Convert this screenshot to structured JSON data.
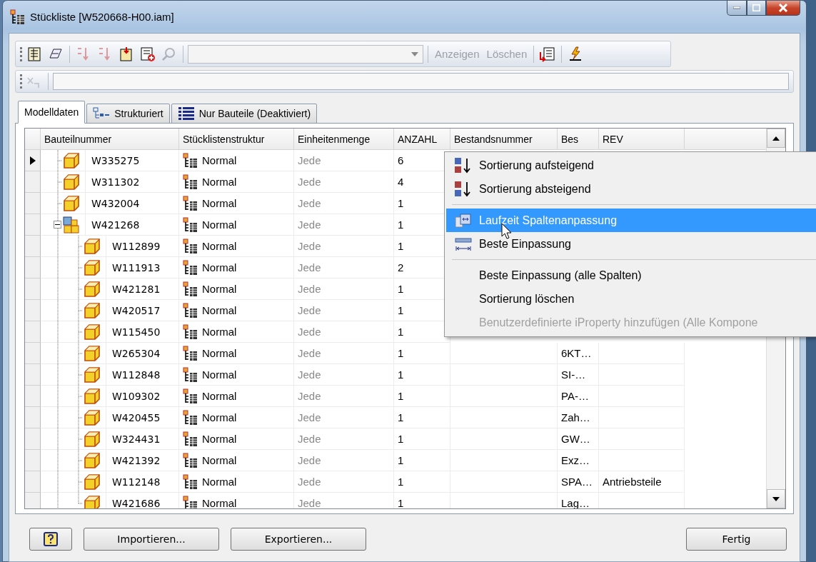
{
  "window": {
    "title": "Stückliste [W520668-H00.iam]"
  },
  "toolbar": {
    "buttons": [
      {
        "label": "Anzeigen",
        "disabled": true
      },
      {
        "label": "Löschen",
        "disabled": true
      }
    ]
  },
  "tabs": [
    {
      "label": "Modelldaten",
      "kind": "plain",
      "selected": true
    },
    {
      "label": "Strukturiert",
      "kind": "structured",
      "selected": false
    },
    {
      "label": "Nur Bauteile (Deaktiviert)",
      "kind": "parts",
      "selected": false
    }
  ],
  "table": {
    "columns": [
      "Bauteilnummer",
      "Stücklistenstruktur",
      "Einheitenmenge",
      "ANZAHL",
      "Bestandsnummer",
      "Bes",
      "REV"
    ],
    "rows": [
      {
        "kind": "part",
        "number": "W335275",
        "structure": "Normal",
        "unit_qty": "Jede",
        "qty": "6",
        "current": true
      },
      {
        "kind": "part",
        "number": "W311302",
        "structure": "Normal",
        "unit_qty": "Jede",
        "qty": "4",
        "current": false
      },
      {
        "kind": "part",
        "number": "W432004",
        "structure": "Normal",
        "unit_qty": "Jede",
        "qty": "1",
        "current": false
      },
      {
        "kind": "assembly",
        "number": "W421268",
        "structure": "Normal",
        "unit_qty": "Jede",
        "qty": "1",
        "current": false,
        "expanded": true,
        "children": [
          {
            "kind": "part",
            "number": "W112899",
            "structure": "Normal",
            "unit_qty": "Jede",
            "qty": "1",
            "current": false
          },
          {
            "kind": "part",
            "number": "W111913",
            "structure": "Normal",
            "unit_qty": "Jede",
            "qty": "2",
            "current": false
          },
          {
            "kind": "part",
            "number": "W421281",
            "structure": "Normal",
            "unit_qty": "Jede",
            "qty": "1",
            "current": false
          },
          {
            "kind": "part",
            "number": "W420517",
            "structure": "Normal",
            "unit_qty": "Jede",
            "qty": "1",
            "current": false
          },
          {
            "kind": "part",
            "number": "W115450",
            "structure": "Normal",
            "unit_qty": "Jede",
            "qty": "1",
            "current": false
          },
          {
            "kind": "part",
            "number": "W265304",
            "structure": "Normal",
            "unit_qty": "Jede",
            "qty": "1",
            "current": false,
            "bes": "6KT…"
          },
          {
            "kind": "part",
            "number": "W112848",
            "structure": "Normal",
            "unit_qty": "Jede",
            "qty": "1",
            "current": false,
            "bes": "SI-…"
          },
          {
            "kind": "part",
            "number": "W109302",
            "structure": "Normal",
            "unit_qty": "Jede",
            "qty": "1",
            "current": false,
            "bes": "PA-…"
          },
          {
            "kind": "part",
            "number": "W420455",
            "structure": "Normal",
            "unit_qty": "Jede",
            "qty": "1",
            "current": false,
            "bes": "Zah…"
          },
          {
            "kind": "part",
            "number": "W324431",
            "structure": "Normal",
            "unit_qty": "Jede",
            "qty": "1",
            "current": false,
            "bes": "GW…"
          },
          {
            "kind": "part",
            "number": "W421392",
            "structure": "Normal",
            "unit_qty": "Jede",
            "qty": "1",
            "current": false,
            "bes": "Exz…"
          },
          {
            "kind": "part",
            "number": "W112148",
            "structure": "Normal",
            "unit_qty": "Jede",
            "qty": "1",
            "current": false,
            "bes": "SPA…",
            "rev": "Antriebsteile"
          },
          {
            "kind": "part",
            "number": "W421686",
            "structure": "Normal",
            "unit_qty": "Jede",
            "qty": "1",
            "current": false,
            "bes": "Lag…"
          }
        ]
      }
    ]
  },
  "context_menu": {
    "items": [
      {
        "kind": "sort_ascending",
        "label": "Sortierung aufsteigend",
        "highlighted": false,
        "disabled": false
      },
      {
        "kind": "sort_descending",
        "label": "Sortierung absteigend",
        "highlighted": false,
        "disabled": false
      },
      {
        "kind": "separator"
      },
      {
        "kind": "column_fit",
        "label": "Laufzeit Spaltenanpassung",
        "highlighted": true,
        "disabled": false
      },
      {
        "kind": "best_fit",
        "label": "Beste Einpassung",
        "highlighted": false,
        "disabled": false
      },
      {
        "kind": "separator"
      },
      {
        "kind": "plain",
        "label": "Beste Einpassung (alle Spalten)",
        "highlighted": false,
        "disabled": false
      },
      {
        "kind": "plain",
        "label": "Sortierung löschen",
        "highlighted": false,
        "disabled": false
      },
      {
        "kind": "plain",
        "label": "Benutzerdefinierte iProperty hinzufügen (Alle Kompone",
        "highlighted": false,
        "disabled": true
      }
    ]
  },
  "buttons": {
    "left": [
      "Importieren...",
      "Exportieren..."
    ],
    "right": [
      "Fertig"
    ]
  }
}
